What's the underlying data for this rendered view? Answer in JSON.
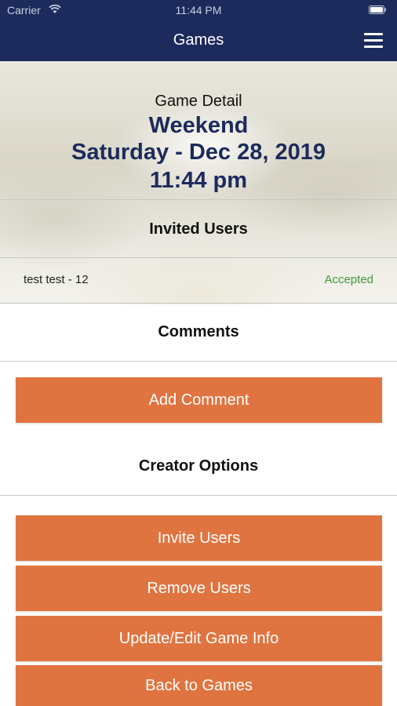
{
  "status_bar": {
    "carrier": "Carrier",
    "time": "11:44 PM"
  },
  "nav": {
    "title": "Games",
    "menu_icon": "hamburger-menu-icon"
  },
  "game": {
    "heading": "Game Detail",
    "name": "Weekend",
    "date": "Saturday - Dec 28, 2019",
    "time": "11:44 pm"
  },
  "invited": {
    "title": "Invited Users",
    "users": [
      {
        "name": "test test - 12",
        "status": "Accepted"
      }
    ]
  },
  "comments": {
    "title": "Comments",
    "add_label": "Add Comment"
  },
  "creator": {
    "title": "Creator Options",
    "buttons": [
      "Invite Users",
      "Remove Users",
      "Update/Edit Game Info",
      "Back to Games"
    ]
  },
  "colors": {
    "navbar": "#1c2b5c",
    "accent": "#e07440",
    "accepted": "#3f9a3a"
  }
}
